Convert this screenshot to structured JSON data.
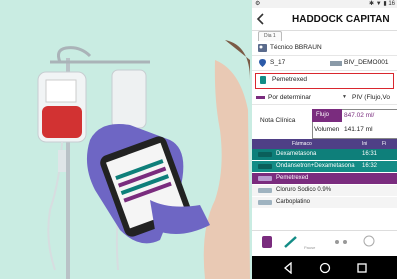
{
  "app": {
    "title": "HADDOCK CAPITAN",
    "tab_label": "Dia 1"
  },
  "status_bar": {
    "left": "⚙",
    "right": "✱ ▼ ▮ 16"
  },
  "patient": {
    "technician": "Técnico BBRAUN",
    "location": "S_17",
    "device": "BIV_DEMO001"
  },
  "drug": {
    "selected": "Pemetrexed"
  },
  "route": {
    "selector_value": "Por determinar",
    "line_value": "PIV (Flujo,Vo"
  },
  "clinical": {
    "label": "Nota Clínica",
    "flow_label": "Flujo",
    "flow_value": "847.02 ml/",
    "volume_label": "Volumen",
    "volume_value": "141.17 ml"
  },
  "table": {
    "headers": [
      "Fármaco",
      "Ini",
      "Fi"
    ],
    "rows": [
      {
        "name": "Dexametasona",
        "time": "16:31",
        "style": "teal"
      },
      {
        "name": "Ondansetron+Dexametasona",
        "time": "16:32",
        "style": "teal2"
      },
      {
        "name": "Pemetrexed",
        "time": "",
        "style": "purple"
      },
      {
        "name": "Cloruro Sodico 0.9%",
        "time": "",
        "style": "light"
      },
      {
        "name": "Carboplatino",
        "time": "",
        "style": "light"
      }
    ]
  },
  "toolbar": {
    "items": [
      "",
      "",
      "Pause",
      "",
      ""
    ],
    "second_caption": "Clean"
  },
  "colors": {
    "background": "#c9ece2",
    "teal": "#0e7f7a",
    "purple": "#7a2c7e",
    "header": "#4f3f86",
    "alert": "#d9272e"
  }
}
